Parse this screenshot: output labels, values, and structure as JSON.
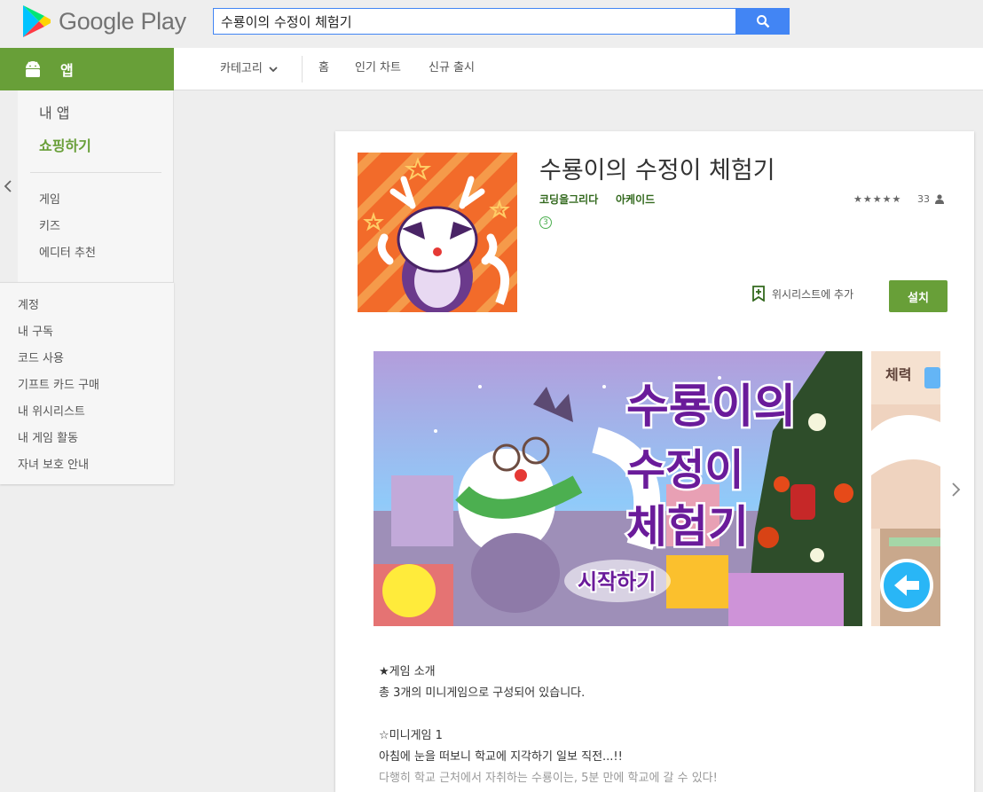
{
  "header": {
    "brand": "Google Play",
    "search_value": "수룡이의 수정이 체험기"
  },
  "appbar": {
    "label": "앱"
  },
  "nav": {
    "categories": "카테고리",
    "home": "홈",
    "top_charts": "인기 차트",
    "new_releases": "신규 출시"
  },
  "sidebar": {
    "my_apps": "내 앱",
    "shop": "쇼핑하기",
    "sub_items": [
      "게임",
      "키즈",
      "에디터 추천"
    ],
    "account_items": [
      "계정",
      "내 구독",
      "코드 사용",
      "기프트 카드 구매",
      "내 위시리스트",
      "내 게임 활동",
      "자녀 보호 안내"
    ]
  },
  "app": {
    "title": "수룡이의 수정이 체험기",
    "developer": "코딩을그리다",
    "category": "아케이드",
    "content_rating": "3",
    "stars": "★★★★★",
    "rating_count": "33",
    "wishlist_label": "위시리스트에 추가",
    "install_label": "설치"
  },
  "screenshot1": {
    "title_lines": [
      "수룡이의",
      "수정이",
      "체험기"
    ],
    "start_label": "시작하기"
  },
  "screenshot2": {
    "label": "체력"
  },
  "description": [
    "★게임 소개",
    "총 3개의 미니게임으로 구성되어 있습니다.",
    "",
    "☆미니게임 1",
    "아침에 눈을 떠보니 학교에 지각하기 일보 직전...!!",
    "다행히 학교 근처에서 자취하는 수룡이는, 5분 만에 학교에 갈 수 있다!"
  ],
  "colors": {
    "brand_green": "#689f38",
    "dev_green": "#33691e",
    "search_blue": "#4285f4"
  }
}
